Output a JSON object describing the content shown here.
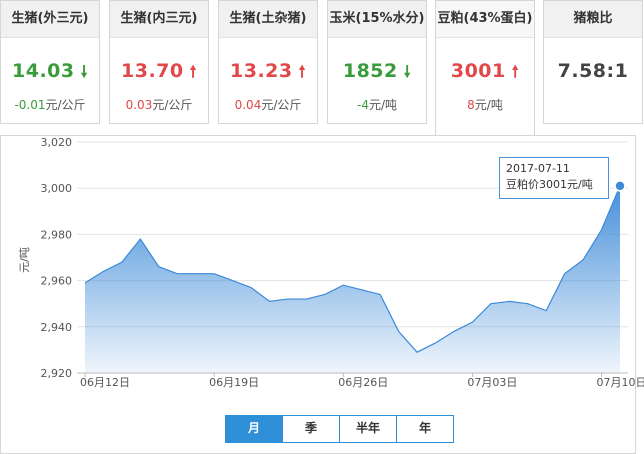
{
  "cards": [
    {
      "title": "生猪(外三元)",
      "price": "14.03",
      "dir": "down",
      "change": "-0.01",
      "unit": "元/公斤"
    },
    {
      "title": "生猪(内三元)",
      "price": "13.70",
      "dir": "up",
      "change": "0.03",
      "unit": "元/公斤"
    },
    {
      "title": "生猪(土杂猪)",
      "price": "13.23",
      "dir": "up",
      "change": "0.04",
      "unit": "元/公斤"
    },
    {
      "title": "玉米(15%水分)",
      "price": "1852",
      "dir": "down",
      "change": "-4",
      "unit": "元/吨"
    },
    {
      "title": "豆粕(43%蛋白)",
      "price": "3001",
      "dir": "up",
      "change": "8",
      "unit": "元/吨"
    },
    {
      "title": "猪粮比",
      "price": "7.58:1"
    }
  ],
  "colors": {
    "up": "#e0484a",
    "down": "#3a9b3a",
    "accent": "#2f8fd8"
  },
  "tooltip": {
    "date": "2017-07-11",
    "text": "豆粕价3001元/吨"
  },
  "periods": [
    "月",
    "季",
    "半年",
    "年"
  ],
  "chart_data": {
    "type": "area",
    "ylabel": "元/吨",
    "ylim": [
      2920,
      3020
    ],
    "yticks": [
      "3,020",
      "3,000",
      "2,980",
      "2,960",
      "2,940",
      "2,920"
    ],
    "xticks": [
      "06月12日",
      "06月19日",
      "06月26日",
      "07月03日",
      "07月10日"
    ],
    "x": [
      "06-12",
      "06-13",
      "06-14",
      "06-15",
      "06-16",
      "06-17",
      "06-18",
      "06-19",
      "06-20",
      "06-21",
      "06-22",
      "06-23",
      "06-24",
      "06-25",
      "06-26",
      "06-27",
      "06-28",
      "06-29",
      "06-30",
      "07-01",
      "07-02",
      "07-03",
      "07-04",
      "07-05",
      "07-06",
      "07-07",
      "07-08",
      "07-09",
      "07-10",
      "07-11"
    ],
    "values": [
      2959,
      2964,
      2968,
      2978,
      2966,
      2963,
      2963,
      2963,
      2960,
      2957,
      2951,
      2952,
      2952,
      2954,
      2958,
      2956,
      2954,
      2938,
      2929,
      2933,
      2938,
      2942,
      2950,
      2951,
      2950,
      2947,
      2963,
      2969,
      2982,
      3001
    ]
  }
}
